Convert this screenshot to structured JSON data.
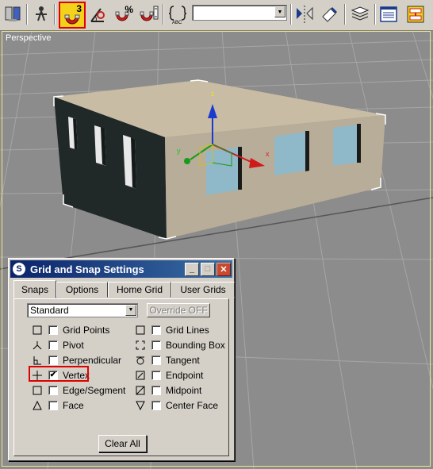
{
  "toolbar": {
    "icons": [
      "select-and-link-icon",
      "select-tool-icon",
      "snap-toggle-3d-icon",
      "angle-snap-icon",
      "percent-snap-icon",
      "spinner-snap-icon",
      "edit-named-selection-icon",
      "mirror-icon",
      "align-icon",
      "layer-manager-icon",
      "curve-editor-icon",
      "schematic-view-icon"
    ],
    "snap_toggle_label": "3",
    "percent_label": "%",
    "named_selection_value": ""
  },
  "viewport": {
    "label": "Perspective",
    "axes": {
      "x": "x",
      "y": "y",
      "z": "z"
    }
  },
  "dialog": {
    "title": "Grid and Snap Settings",
    "tabs": [
      {
        "label": "Snaps",
        "active": true
      },
      {
        "label": "Options",
        "active": false
      },
      {
        "label": "Home Grid",
        "active": false
      },
      {
        "label": "User Grids",
        "active": false
      }
    ],
    "snap_type": "Standard",
    "override_label": "Override OFF",
    "left_options": [
      {
        "label": "Grid Points",
        "checked": false,
        "icon": "grid-points-icon"
      },
      {
        "label": "Pivot",
        "checked": false,
        "icon": "pivot-icon"
      },
      {
        "label": "Perpendicular",
        "checked": false,
        "icon": "perpendicular-icon"
      },
      {
        "label": "Vertex",
        "checked": true,
        "icon": "vertex-icon"
      },
      {
        "label": "Edge/Segment",
        "checked": false,
        "icon": "edge-segment-icon"
      },
      {
        "label": "Face",
        "checked": false,
        "icon": "face-icon"
      }
    ],
    "right_options": [
      {
        "label": "Grid Lines",
        "checked": false,
        "icon": "grid-lines-icon"
      },
      {
        "label": "Bounding Box",
        "checked": false,
        "icon": "bounding-box-icon"
      },
      {
        "label": "Tangent",
        "checked": false,
        "icon": "tangent-icon"
      },
      {
        "label": "Endpoint",
        "checked": false,
        "icon": "endpoint-icon"
      },
      {
        "label": "Midpoint",
        "checked": false,
        "icon": "midpoint-icon"
      },
      {
        "label": "Center Face",
        "checked": false,
        "icon": "center-face-icon"
      }
    ],
    "clear_all_label": "Clear All",
    "check_mark": "✔",
    "minimize_glyph": "_",
    "maximize_glyph": "□",
    "close_glyph": "✕",
    "app_icon_glyph": "S",
    "dropdown_glyph": "▼"
  }
}
